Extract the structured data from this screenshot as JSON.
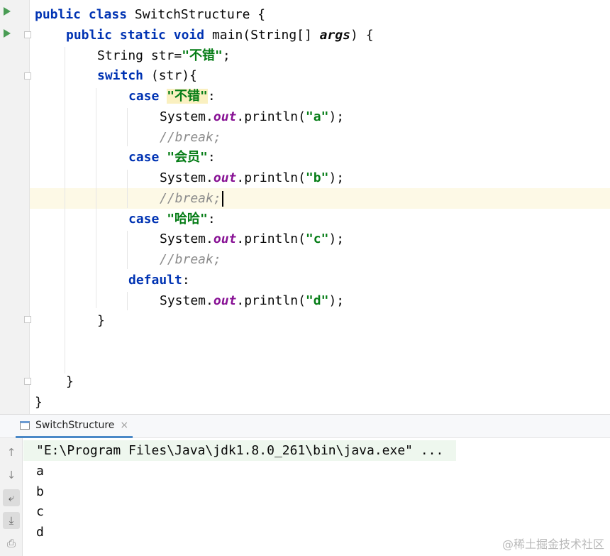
{
  "editor": {
    "l1": {
      "k1": "public",
      "k2": "class",
      "name": "SwitchStructure {"
    },
    "l2": {
      "k1": "public",
      "k2": "static",
      "k3": "void",
      "t1": "main(String[] ",
      "param": "args",
      "t2": ") {"
    },
    "l3": {
      "t1": "String str=",
      "s1": "\"不错\"",
      "t2": ";"
    },
    "l4": {
      "k1": "switch",
      "t1": " (str){"
    },
    "l5": {
      "k1": "case",
      "s1": "\"不错\"",
      "t1": ":"
    },
    "l6": {
      "t1": "System.",
      "f1": "out",
      "t2": ".println(",
      "s1": "\"a\"",
      "t3": ");"
    },
    "l7": {
      "c1": "//break;"
    },
    "l8": {
      "k1": "case",
      "s1": "\"会员\"",
      "t1": ":"
    },
    "l9": {
      "t1": "System.",
      "f1": "out",
      "t2": ".println(",
      "s1": "\"b\"",
      "t3": ");"
    },
    "l10": {
      "c1": "//break;"
    },
    "l11": {
      "k1": "case",
      "s1": "\"哈哈\"",
      "t1": ":"
    },
    "l12": {
      "t1": "System.",
      "f1": "out",
      "t2": ".println(",
      "s1": "\"c\"",
      "t3": ");"
    },
    "l13": {
      "c1": "//break;"
    },
    "l14": {
      "k1": "default",
      "t1": ":"
    },
    "l15": {
      "t1": "System.",
      "f1": "out",
      "t2": ".println(",
      "s1": "\"d\"",
      "t3": ");"
    },
    "l16": {
      "t1": "}"
    },
    "l19": {
      "t1": "}"
    },
    "l20": {
      "t1": "}"
    }
  },
  "console": {
    "tab_label": "SwitchStructure",
    "tab_close": "×",
    "command": "\"E:\\Program Files\\Java\\jdk1.8.0_261\\bin\\java.exe\" ...",
    "output": [
      "a",
      "b",
      "c",
      "d"
    ]
  },
  "toolbar": {
    "up_icon": "↑",
    "down_icon": "↓",
    "wrap_icon": "⤶",
    "scroll_end_icon": "⤓",
    "print_icon": "⎙"
  },
  "watermark": "@稀土掘金技术社区",
  "colors": {
    "keyword": "#0033b3",
    "string": "#067d17",
    "comment": "#8c8c8c",
    "field": "#871094",
    "run": "#499c54",
    "tab_underline": "#4a88c7"
  }
}
